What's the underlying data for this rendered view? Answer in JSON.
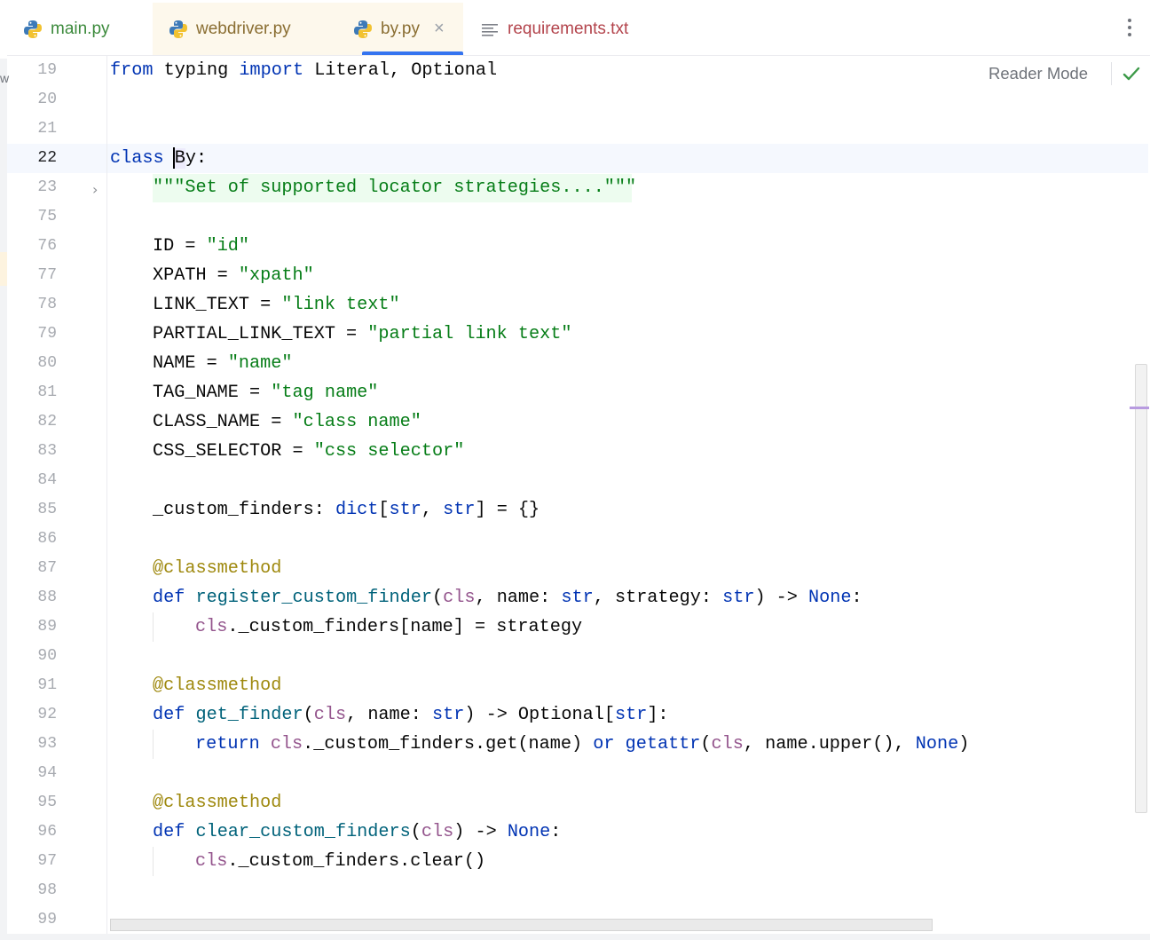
{
  "tabs": [
    {
      "label": "main.py",
      "icon": "python-icon"
    },
    {
      "label": "webdriver.py",
      "icon": "python-icon"
    },
    {
      "label": "by.py",
      "icon": "python-icon",
      "active": true,
      "close": "×"
    },
    {
      "label": "requirements.txt",
      "icon": "text-file-icon"
    }
  ],
  "toolbar": {
    "reader_mode": "Reader Mode",
    "status_icon": "check-icon",
    "more_icon": "more-vertical-icon"
  },
  "gutter": {
    "line_numbers": [
      "19",
      "20",
      "21",
      "22",
      "23",
      "75",
      "76",
      "77",
      "78",
      "79",
      "80",
      "81",
      "82",
      "83",
      "84",
      "85",
      "86",
      "87",
      "88",
      "89",
      "90",
      "91",
      "92",
      "93",
      "94",
      "95",
      "96",
      "97",
      "98",
      "99"
    ],
    "current_line": "22",
    "folded_line": "23"
  },
  "code": {
    "l19": {
      "from": "from",
      "mod": " typing ",
      "import": "import",
      "rest": " Literal, Optional"
    },
    "l22": {
      "kw": "class",
      "sp": " ",
      "b": "B",
      "rest": "y:"
    },
    "l23": {
      "doc": "\"\"\"Set of supported locator strategies....\"\"\""
    },
    "l76": {
      "name": "ID = ",
      "value": "\"id\""
    },
    "l77": {
      "name": "XPATH = ",
      "value": "\"xpath\""
    },
    "l78": {
      "name": "LINK_TEXT = ",
      "value": "\"link text\""
    },
    "l79": {
      "name": "PARTIAL_LINK_TEXT = ",
      "value": "\"partial link text\""
    },
    "l80": {
      "name": "NAME = ",
      "value": "\"name\""
    },
    "l81": {
      "name": "TAG_NAME = ",
      "value": "\"tag name\""
    },
    "l82": {
      "name": "CLASS_NAME = ",
      "value": "\"class name\""
    },
    "l83": {
      "name": "CSS_SELECTOR = ",
      "value": "\"css selector\""
    },
    "l85": {
      "a": "_custom_finders: ",
      "dict": "dict",
      "b": "[",
      "s1": "str",
      "c": ", ",
      "s2": "str",
      "d": "] = {}"
    },
    "decorator": "@classmethod",
    "l88": {
      "def": "def",
      "fn": "register_custom_finder",
      "p1": "(",
      "cls": "cls",
      "p2": ", name: ",
      "s1": "str",
      "p3": ", strategy: ",
      "s2": "str",
      "p4": ") -> ",
      "none": "None",
      "p5": ":"
    },
    "l89": {
      "cls": "cls",
      "rest": "._custom_finders[name] = strategy"
    },
    "l92": {
      "def": "def",
      "fn": "get_finder",
      "p1": "(",
      "cls": "cls",
      "p2": ", name: ",
      "s1": "str",
      "p3": ") -> Optional[",
      "s2": "str",
      "p4": "]:"
    },
    "l93": {
      "ret": "return",
      "cls": "cls",
      "mid": "._custom_finders.get(name) ",
      "or": "or",
      "getattr": "getattr",
      "p1": "(",
      "cls2": "cls",
      "p2": ", name.upper(), ",
      "none": "None",
      "p3": ")"
    },
    "l96": {
      "def": "def",
      "fn": "clear_custom_finders",
      "p1": "(",
      "cls": "cls",
      "p2": ") -> ",
      "none": "None",
      "p3": ":"
    },
    "l97": {
      "cls": "cls",
      "rest": "._custom_finders.clear()"
    }
  },
  "left_edge_char": "w"
}
